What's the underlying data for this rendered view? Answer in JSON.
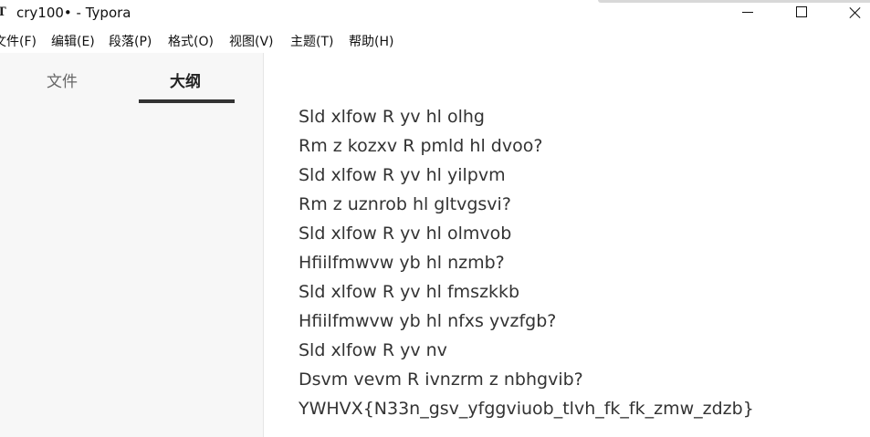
{
  "window": {
    "icon_glyph": "T",
    "title": "cry100• - Typora",
    "controls": [
      "minimize-icon",
      "maximize-icon",
      "close-icon"
    ]
  },
  "menu": {
    "items": [
      {
        "label": "文件(F)"
      },
      {
        "label": "编辑(E)"
      },
      {
        "label": "段落(P)"
      },
      {
        "label": "格式(O)"
      },
      {
        "label": "视图(V)"
      },
      {
        "label": "主题(T)"
      },
      {
        "label": "帮助(H)"
      }
    ]
  },
  "sidebar": {
    "tabs": [
      {
        "label": "文件",
        "active": false
      },
      {
        "label": "大纲",
        "active": true
      }
    ]
  },
  "document": {
    "lines": [
      "Sld xlfow R yv hl olhg",
      "Rm z kozxv R pmld hl dvoo?",
      "Sld xlfow R yv hl yilpvm",
      "Rm z uznrob hl gltvgsvi?",
      "Sld xlfow R yv hl olmvob",
      "Hfiilfmwvw yb hl nzmb?",
      "Sld xlfow R yv hl fmszkkb",
      "Hfiilfmwvw yb hl nfxs yvzfgb?",
      "Sld xlfow R yv nv",
      "Dsvm vevm R ivnzrm z nbhgvib?",
      "YWHVX{N33n_gsv_yfggviuob_tlvh_fk_fk_zmw_zdzb}"
    ]
  },
  "colors": {
    "sidebar_bg": "#f7f7f7",
    "active_tab_underline": "#333333",
    "text": "#333333"
  }
}
